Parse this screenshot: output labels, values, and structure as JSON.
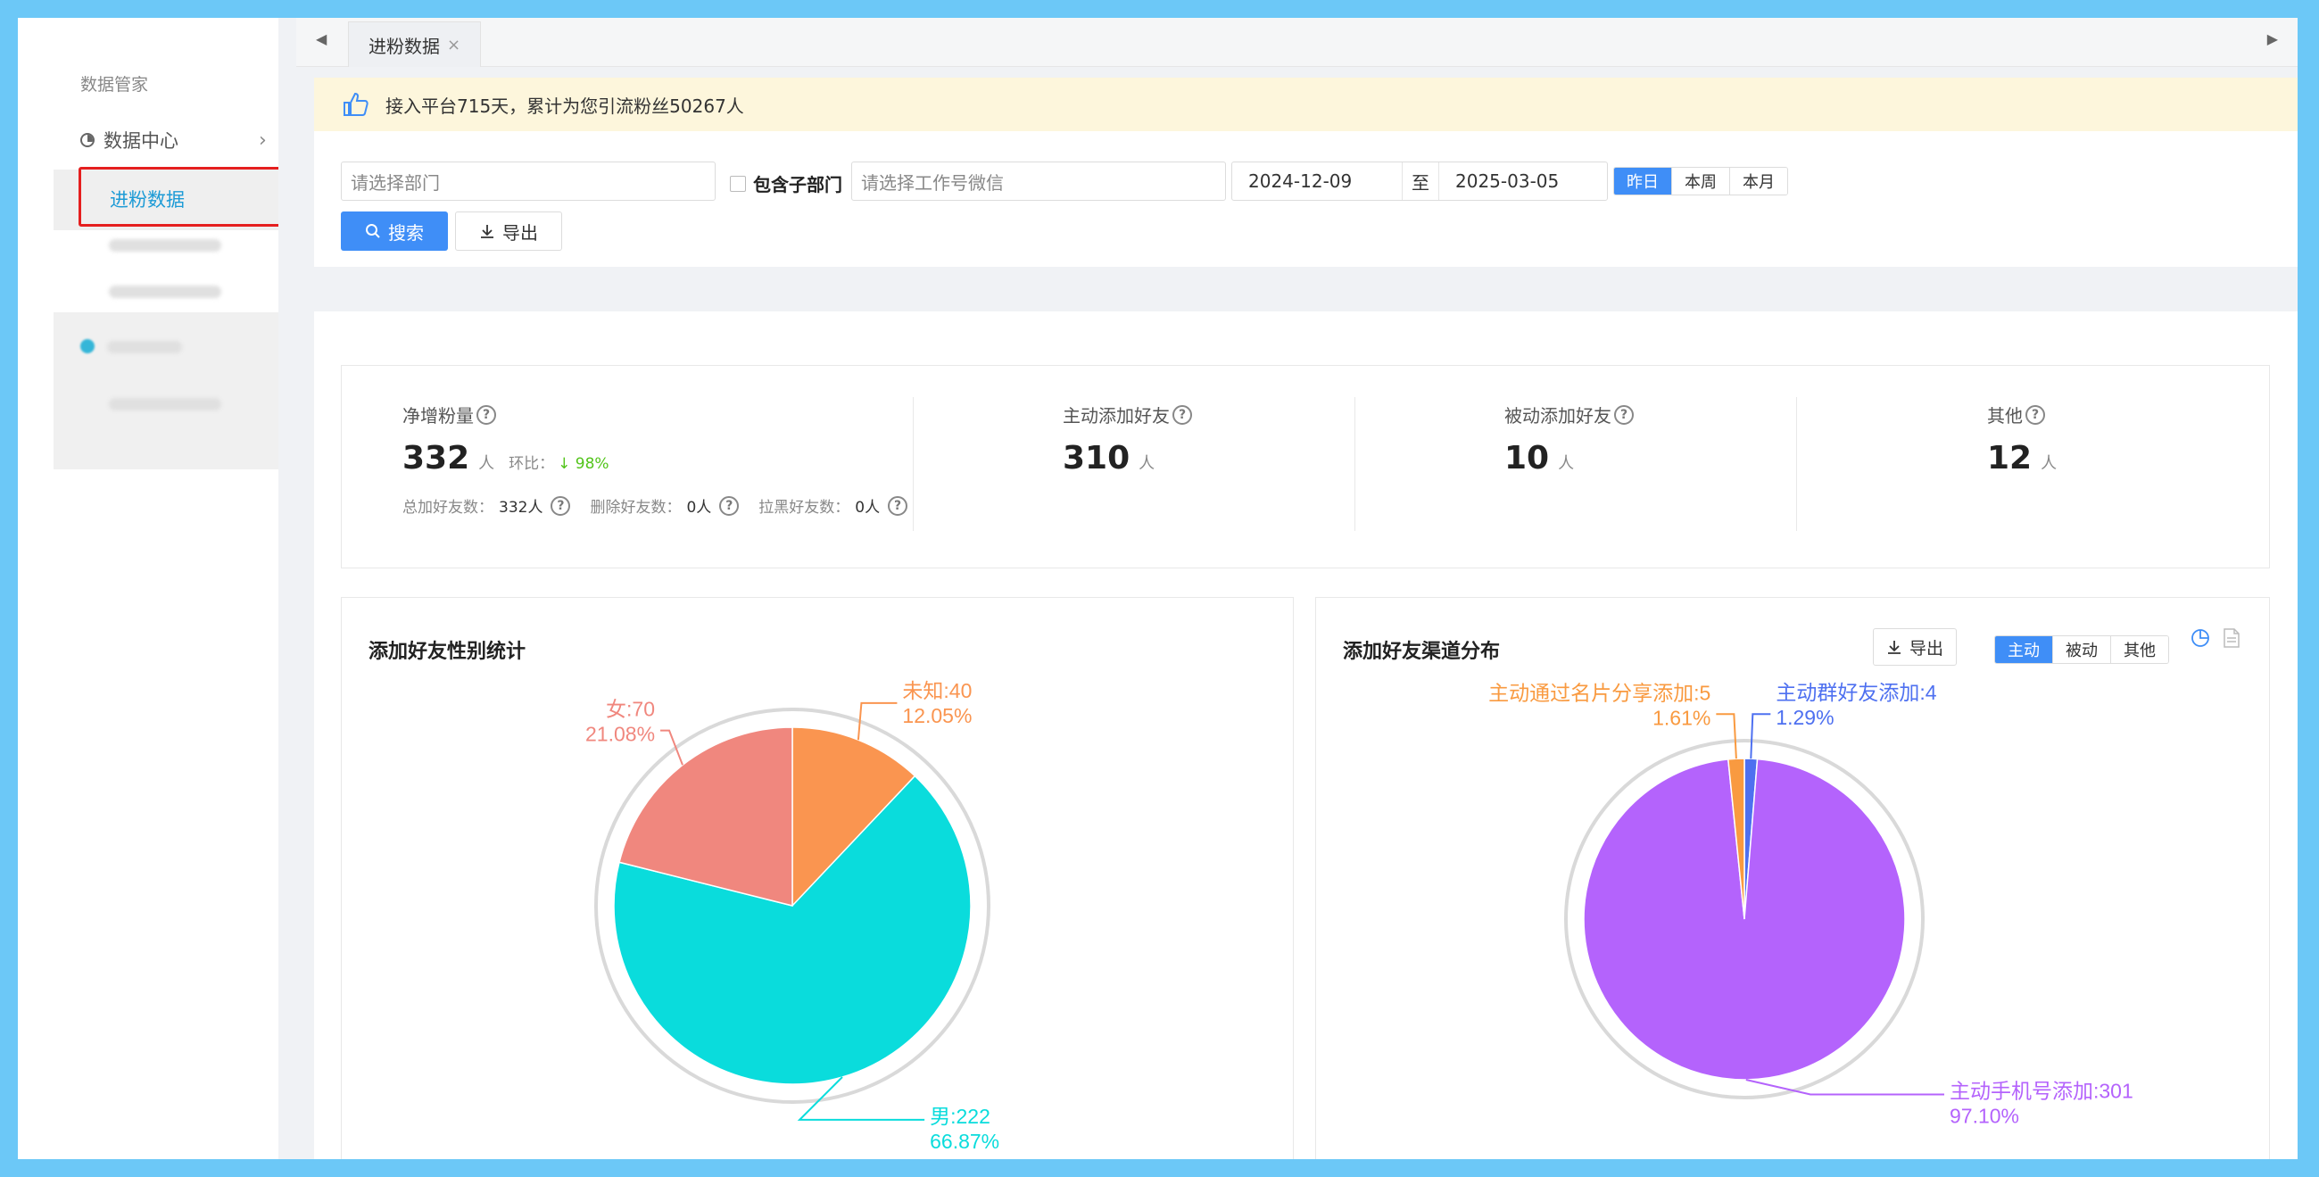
{
  "sidebar": {
    "title": "数据管家",
    "data_center": "数据中心",
    "active_item": "进粉数据"
  },
  "tabs": [
    {
      "label": "进粉数据",
      "close": "×"
    }
  ],
  "notice": {
    "text": "接入平台715天，累计为您引流粉丝50267人"
  },
  "filters": {
    "dept_placeholder": "请选择部门",
    "include_sub": "包含子部门",
    "wechat_placeholder": "请选择工作号微信",
    "date_start": "2024-12-09",
    "date_sep": "至",
    "date_end": "2025-03-05",
    "quick_ranges": [
      "昨日",
      "本周",
      "本月"
    ],
    "search_label": "搜索",
    "export_label": "导出"
  },
  "stats": {
    "net": {
      "label": "净增粉量",
      "value": "332",
      "unit": "人",
      "ring_label": "环比：",
      "ring_value": "↓ 98%",
      "sub": [
        {
          "label": "总加好友数：",
          "value": "332人"
        },
        {
          "label": "删除好友数：",
          "value": "0人"
        },
        {
          "label": "拉黑好友数：",
          "value": "0人"
        }
      ]
    },
    "active": {
      "label": "主动添加好友",
      "value": "310",
      "unit": "人"
    },
    "passive": {
      "label": "被动添加好友",
      "value": "10",
      "unit": "人"
    },
    "other": {
      "label": "其他",
      "value": "12",
      "unit": "人"
    },
    "help": "?"
  },
  "gender_card": {
    "title": "添加好友性别统计"
  },
  "channel_card": {
    "title": "添加好友渠道分布",
    "export_label": "导出",
    "modes": [
      "主动",
      "被动",
      "其他"
    ]
  },
  "chart_data": [
    {
      "type": "pie",
      "title": "添加好友性别统计",
      "slices": [
        {
          "name": "未知",
          "value": 40,
          "percent": "12.05%",
          "label": "未知:40",
          "color": "#fa9550"
        },
        {
          "name": "男",
          "value": 222,
          "percent": "66.87%",
          "label": "男:222",
          "color": "#0adcdc"
        },
        {
          "name": "女",
          "value": 70,
          "percent": "21.08%",
          "label": "女:70",
          "color": "#f0877e"
        }
      ]
    },
    {
      "type": "pie",
      "title": "添加好友渠道分布",
      "slices": [
        {
          "name": "主动群好友添加",
          "value": 4,
          "percent": "1.29%",
          "label": "主动群好友添加:4",
          "color": "#4e70f0"
        },
        {
          "name": "主动手机号添加",
          "value": 301,
          "percent": "97.10%",
          "label": "主动手机号添加:301",
          "color": "#b463fc"
        },
        {
          "name": "主动通过名片分享添加",
          "value": 5,
          "percent": "1.61%",
          "label": "主动通过名片分享添加:5",
          "color": "#f99a40"
        }
      ]
    }
  ]
}
